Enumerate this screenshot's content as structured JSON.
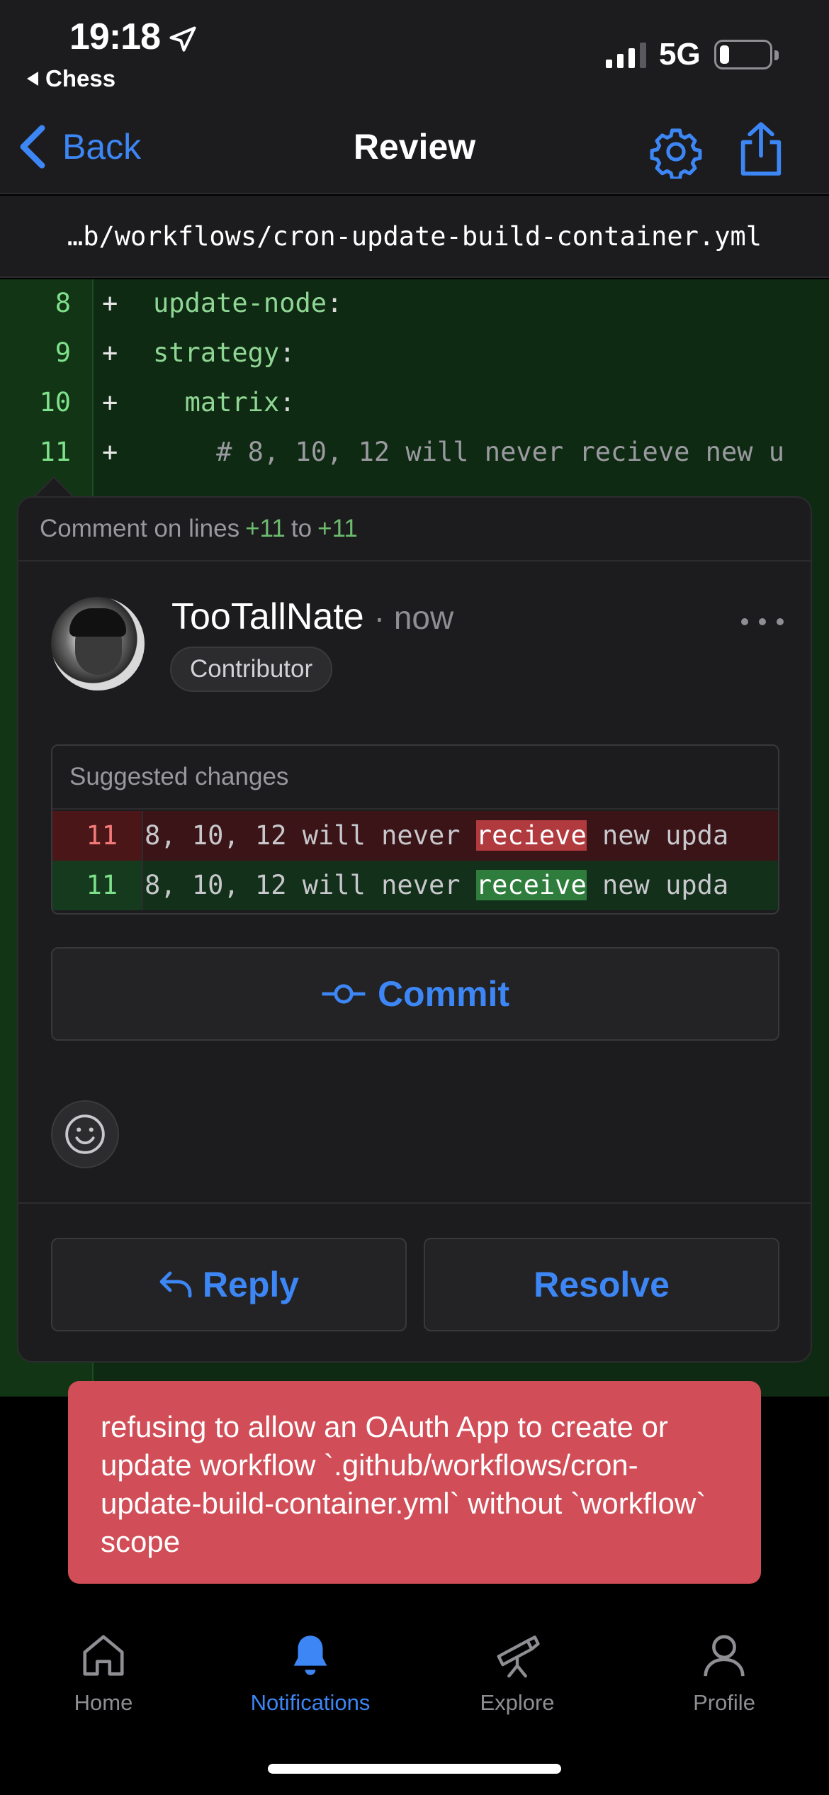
{
  "status_bar": {
    "time": "19:18",
    "back_app": "Chess",
    "network": "5G",
    "battery_percent": 20
  },
  "nav": {
    "back_label": "Back",
    "title": "Review",
    "icons": [
      "gear-icon",
      "share-icon"
    ]
  },
  "file_path": "…b/workflows/cron-update-build-container.yml",
  "diff": {
    "lines": [
      {
        "num": "8",
        "sign": "+",
        "indent": "",
        "key": "update-node",
        "punct": ":",
        "comment": ""
      },
      {
        "num": "9",
        "sign": "+",
        "indent": "",
        "key": "strategy",
        "punct": ":",
        "comment": ""
      },
      {
        "num": "10",
        "sign": "+",
        "indent": "  ",
        "key": "matrix",
        "punct": ":",
        "comment": ""
      },
      {
        "num": "11",
        "sign": "+",
        "indent": "    ",
        "key": "",
        "punct": "",
        "comment": "# 8, 10, 12 will never recieve new u"
      }
    ]
  },
  "comment": {
    "header_prefix": "Comment on lines",
    "line_start": "+11",
    "header_to": "to",
    "line_end": "+11",
    "author": "TooTallNate",
    "time": "· now",
    "role_badge": "Contributor",
    "suggestion": {
      "title": "Suggested changes",
      "removed": {
        "num": "11",
        "before": "8, 10, 12 will never ",
        "highlight": "recieve",
        "after": " new upda"
      },
      "added": {
        "num": "11",
        "before": "8, 10, 12 will never ",
        "highlight": "receive",
        "after": " new upda"
      }
    },
    "commit_label": "Commit",
    "reply_label": "Reply",
    "resolve_label": "Resolve"
  },
  "error_toast": "refusing to allow an OAuth App to create or update workflow `.github/workflows/cron-update-build-container.yml` without `workflow` scope",
  "tabs": [
    {
      "label": "Home",
      "icon": "home-icon",
      "active": false
    },
    {
      "label": "Notifications",
      "icon": "bell-icon",
      "active": true
    },
    {
      "label": "Explore",
      "icon": "telescope-icon",
      "active": false
    },
    {
      "label": "Profile",
      "icon": "person-icon",
      "active": false
    }
  ],
  "colors": {
    "accent": "#3d86f5",
    "toast": "#d14d57",
    "added_bg": "#12301a",
    "removed_bg": "#3a1416"
  }
}
